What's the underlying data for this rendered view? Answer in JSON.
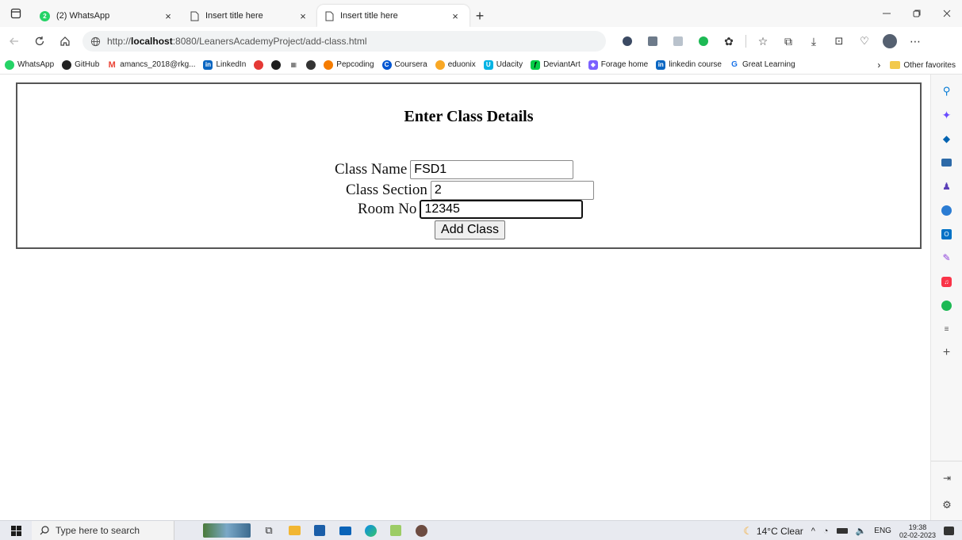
{
  "tabs": [
    {
      "label": "(2) WhatsApp",
      "icon": "whatsapp-icon",
      "badge": "2"
    },
    {
      "label": "Insert title here",
      "icon": "page-icon"
    },
    {
      "label": "Insert title here",
      "icon": "page-icon",
      "active": true
    }
  ],
  "tab_close": "×",
  "new_tab": "+",
  "address": {
    "prefix": "http://",
    "host": "localhost",
    "path": ":8080/LeanersAcademyProject/add-class.html"
  },
  "favorites": [
    {
      "label": "WhatsApp",
      "color": "#25d366"
    },
    {
      "label": "GitHub",
      "color": "#222222"
    },
    {
      "label": "amancs_2018@rkg...",
      "color": "#ea4335"
    },
    {
      "label": "LinkedIn",
      "color": "#0a66c2"
    },
    {
      "label": "",
      "color": "#e53935"
    },
    {
      "label": "",
      "color": "#1e1e1e"
    },
    {
      "label": "",
      "color": "#555555"
    },
    {
      "label": "",
      "color": "#333333"
    },
    {
      "label": "Pepcoding",
      "color": "#f57c00"
    },
    {
      "label": "Coursera",
      "color": "#0056d2"
    },
    {
      "label": "eduonix",
      "color": "#f9a825"
    },
    {
      "label": "Udacity",
      "color": "#02b3e4"
    },
    {
      "label": "DeviantArt",
      "color": "#05cc47"
    },
    {
      "label": "Forage home",
      "color": "#7b61ff"
    },
    {
      "label": "linkedin course",
      "color": "#0a66c2"
    },
    {
      "label": "Great Learning",
      "color": "#1a73e8"
    }
  ],
  "other_favorites": "Other favorites",
  "page": {
    "heading": "Enter Class Details",
    "fields": [
      {
        "label": "Class Name",
        "value": "FSD1"
      },
      {
        "label": "Class Section",
        "value": "2"
      },
      {
        "label": "Room No",
        "value": "12345"
      }
    ],
    "submit": "Add Class"
  },
  "taskbar": {
    "search_placeholder": "Type here to search",
    "weather": "14°C  Clear",
    "language": "ENG",
    "time": "19:38",
    "date": "02-02-2023"
  },
  "colors": {
    "accent": "#0078d4",
    "frame_border": "#555555"
  }
}
